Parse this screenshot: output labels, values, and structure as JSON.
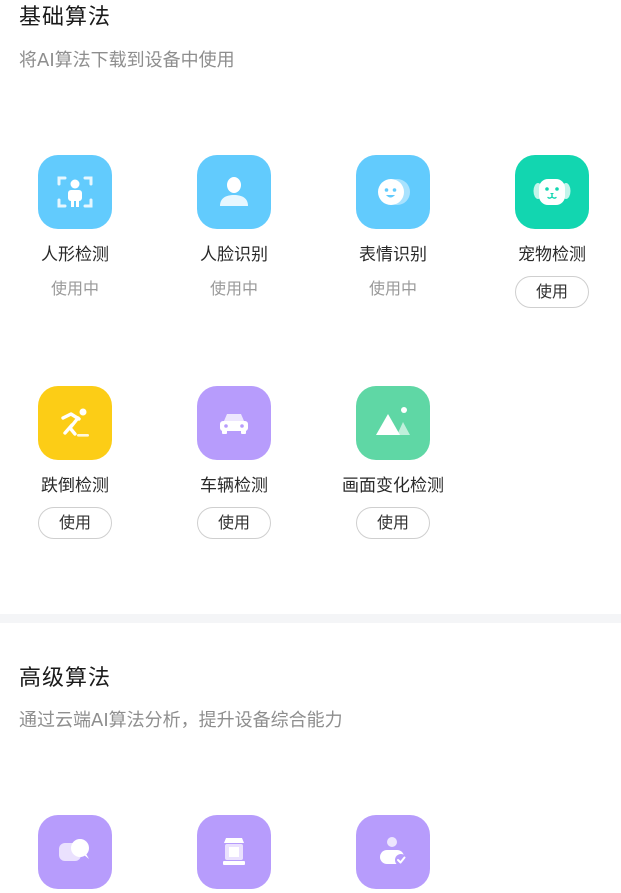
{
  "basic": {
    "title": "基础算法",
    "subtitle": "将AI算法下载到设备中使用",
    "items": [
      {
        "name": "人形检测",
        "status": "使用中",
        "icon": "person-frame-icon",
        "color": "#62cbfd"
      },
      {
        "name": "人脸识别",
        "status": "使用中",
        "icon": "face-user-icon",
        "color": "#62cbfd"
      },
      {
        "name": "表情识别",
        "status": "使用中",
        "icon": "smile-face-icon",
        "color": "#62cbfd"
      },
      {
        "name": "宠物检测",
        "button": "使用",
        "icon": "dog-face-icon",
        "color": "#12d6b0"
      },
      {
        "name": "跌倒检测",
        "button": "使用",
        "icon": "falling-person-icon",
        "color": "#fccd16"
      },
      {
        "name": "车辆检测",
        "button": "使用",
        "icon": "car-icon",
        "color": "#b79cfc"
      },
      {
        "name": "画面变化检测",
        "button": "使用",
        "icon": "landscape-icon",
        "color": "#5fd7a5"
      }
    ]
  },
  "advanced": {
    "title": "高级算法",
    "subtitle": "通过云端AI算法分析，提升设备综合能力",
    "items": [
      {
        "icon": "chat-bubble-icon",
        "color": "#b79cfc"
      },
      {
        "icon": "package-icon",
        "color": "#b79cfc"
      },
      {
        "icon": "user-check-icon",
        "color": "#b79cfc"
      }
    ]
  }
}
